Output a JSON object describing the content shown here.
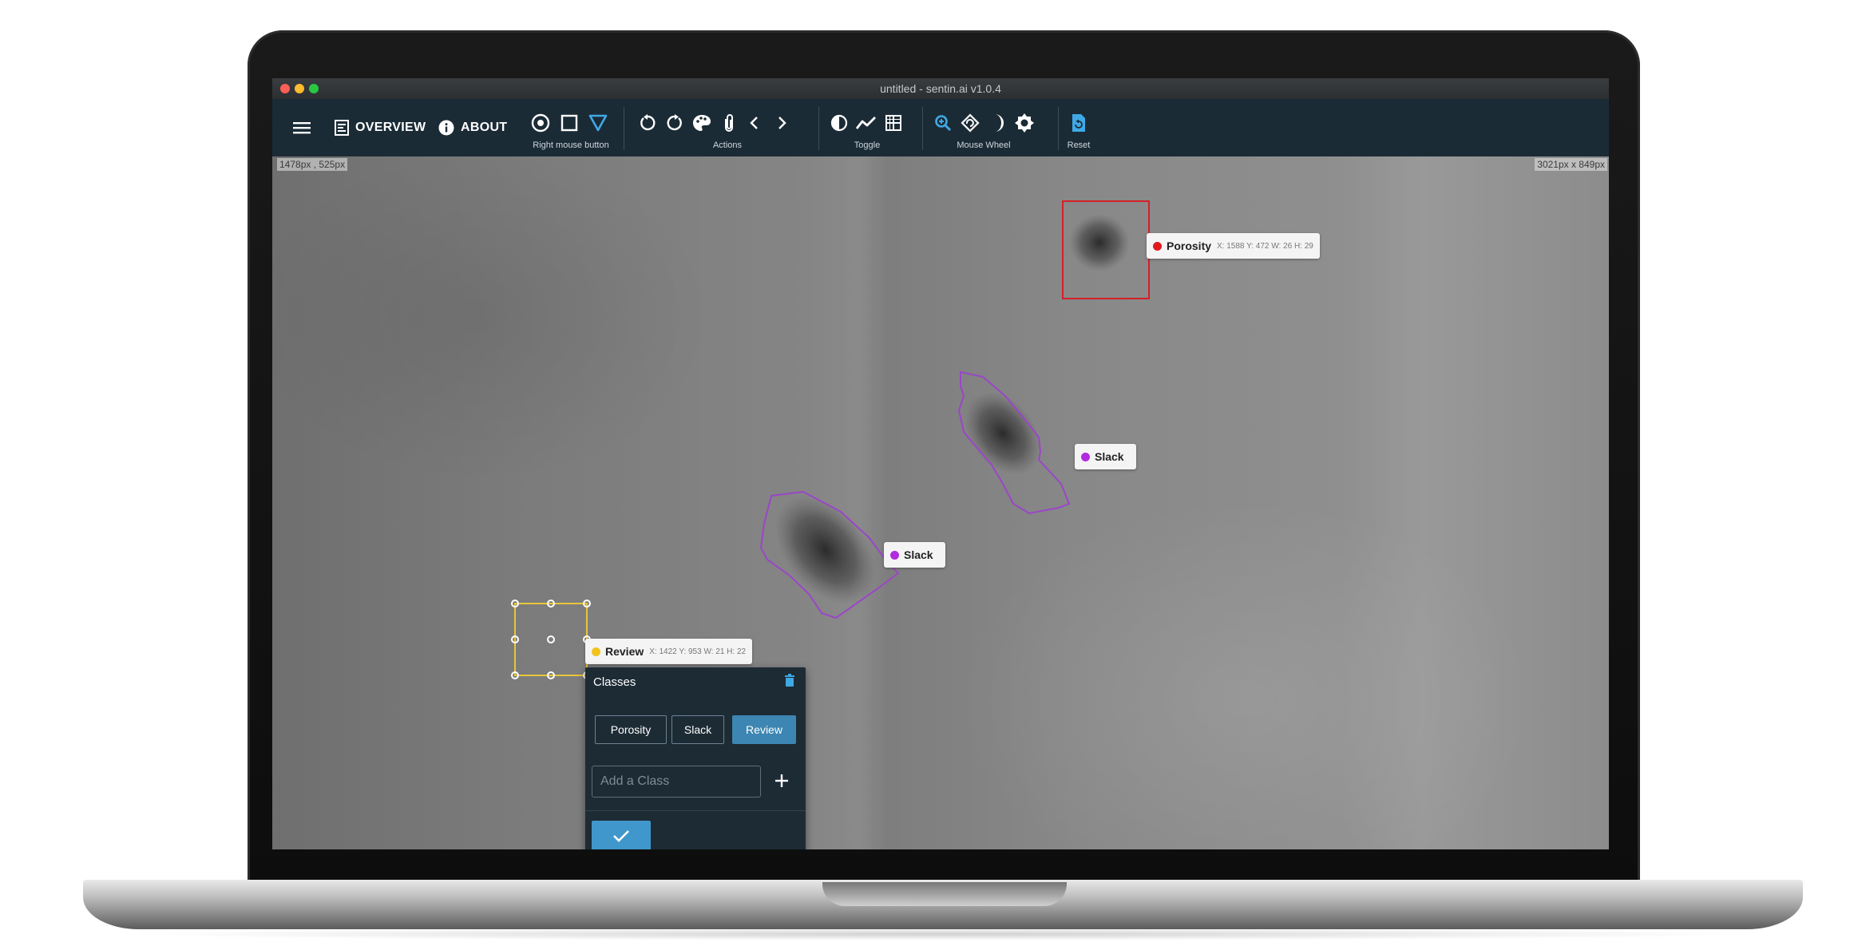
{
  "window": {
    "title": "untitled - sentin.ai v1.0.4"
  },
  "toolbar": {
    "overview_label": "OVERVIEW",
    "about_label": "ABOUT",
    "groups": {
      "right_mouse": "Right mouse button",
      "actions": "Actions",
      "toggle": "Toggle",
      "mouse_wheel": "Mouse Wheel",
      "reset": "Reset"
    },
    "accent_color": "#3fa9e6"
  },
  "canvas": {
    "cursor_coords": "1478px , 525px",
    "image_size": "3021px x 849px"
  },
  "annotations": [
    {
      "class": "Porosity",
      "meta": "X: 1588 Y: 472 W: 26 H: 29",
      "color": "#e0191e"
    },
    {
      "class": "Slack",
      "meta": "",
      "color": "#b12bdf"
    },
    {
      "class": "Slack",
      "meta": "",
      "color": "#b12bdf"
    },
    {
      "class": "Review",
      "meta": "X: 1422 Y: 953 W: 21 H: 22",
      "color": "#f2c31c"
    }
  ],
  "classes_popup": {
    "title": "Classes",
    "options": [
      "Porosity",
      "Slack",
      "Review"
    ],
    "selected": "Review",
    "add_placeholder": "Add a Class",
    "add_icon": "plus-icon",
    "confirm_icon": "check-icon",
    "delete_icon": "trash-icon"
  }
}
